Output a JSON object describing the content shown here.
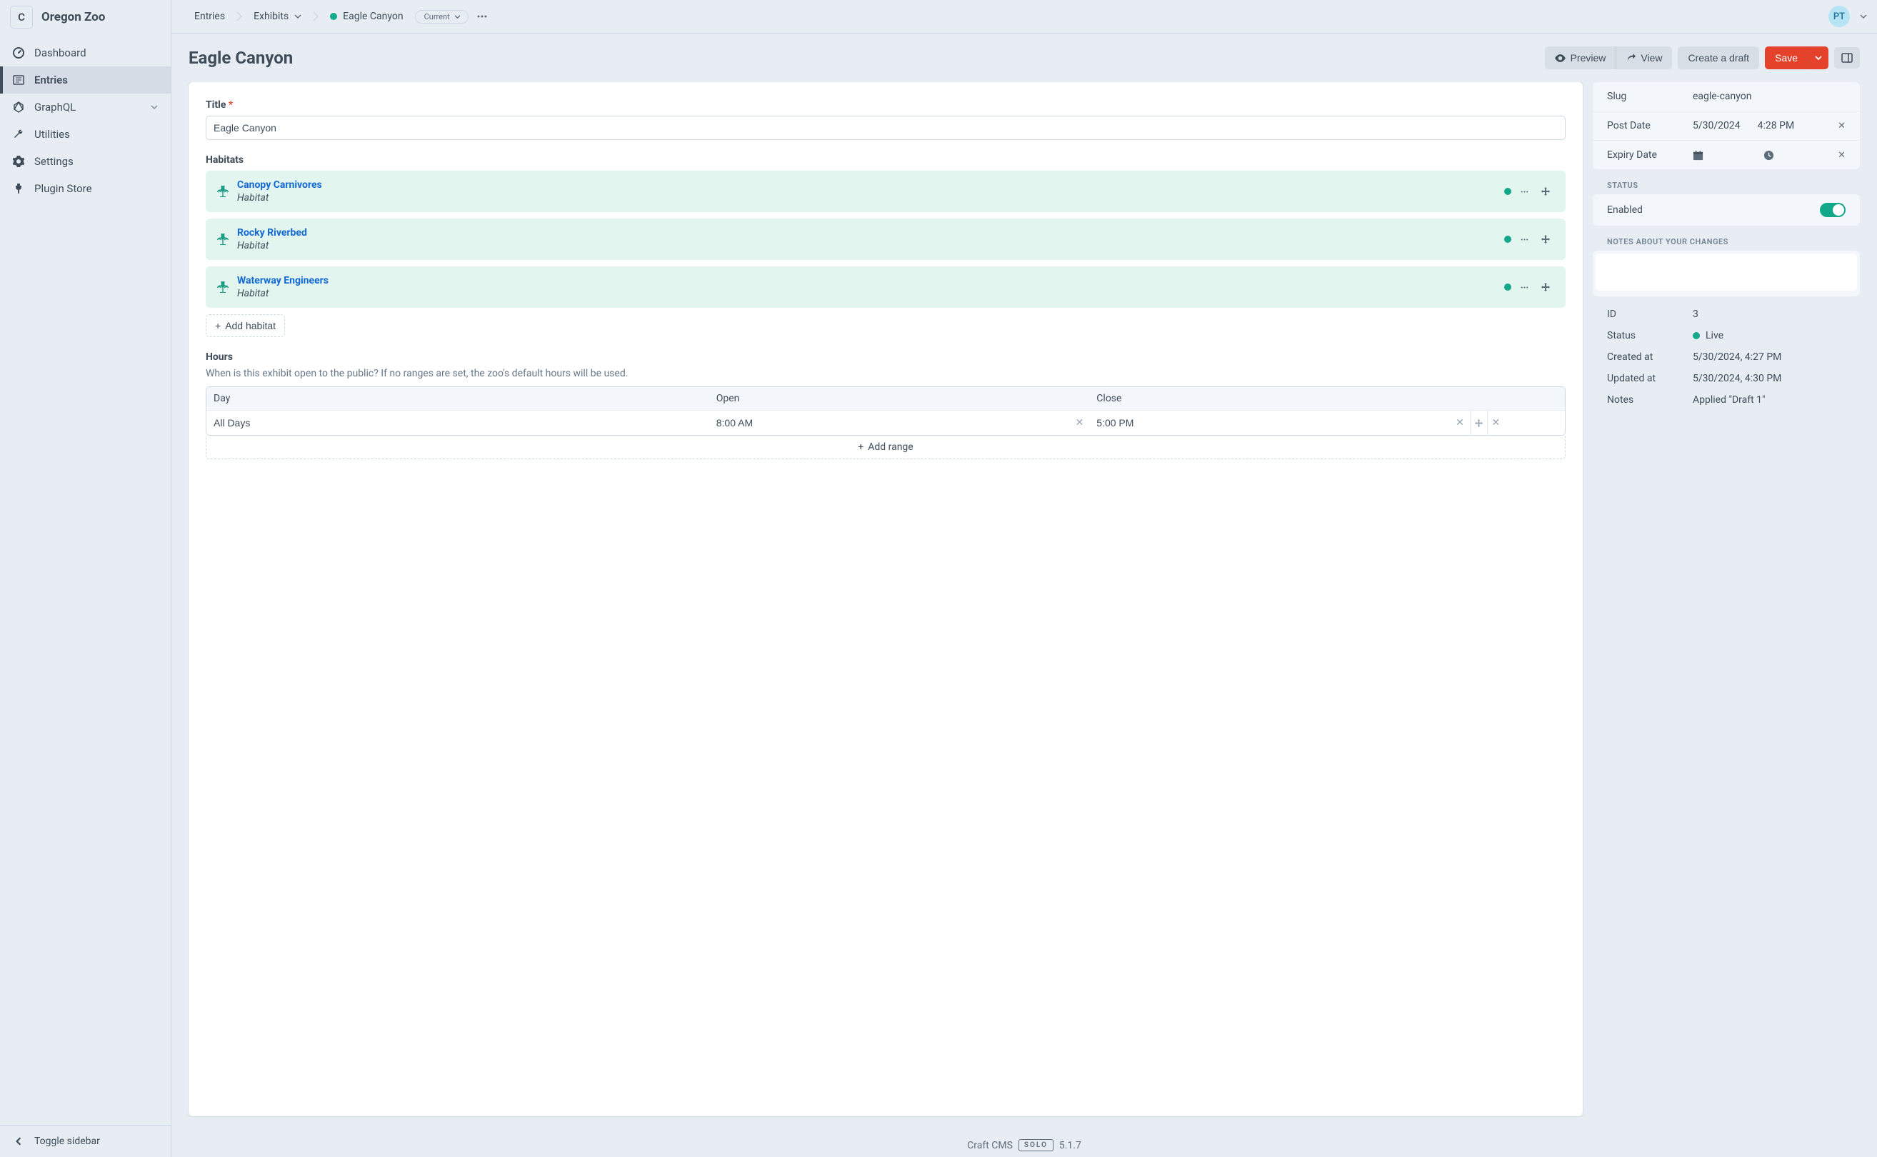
{
  "site": {
    "badge": "C",
    "name": "Oregon Zoo"
  },
  "nav": {
    "dashboard": "Dashboard",
    "entries": "Entries",
    "graphql": "GraphQL",
    "utilities": "Utilities",
    "settings": "Settings",
    "plugin_store": "Plugin Store",
    "toggle_sidebar": "Toggle sidebar"
  },
  "breadcrumb": {
    "entries": "Entries",
    "section": "Exhibits",
    "entry": "Eagle Canyon",
    "revision": "Current"
  },
  "user": {
    "initials": "PT"
  },
  "actions": {
    "preview": "Preview",
    "view": "View",
    "create_draft": "Create a draft",
    "save": "Save"
  },
  "page": {
    "title": "Eagle Canyon"
  },
  "fields": {
    "title_label": "Title",
    "title_value": "Eagle Canyon",
    "habitats_label": "Habitats",
    "add_habitat": "Add habitat",
    "hours_label": "Hours",
    "hours_help": "When is this exhibit open to the public? If no ranges are set, the zoo's default hours will be used.",
    "add_range": "Add range"
  },
  "habitats": [
    {
      "title": "Canopy Carnivores",
      "type": "Habitat"
    },
    {
      "title": "Rocky Riverbed",
      "type": "Habitat"
    },
    {
      "title": "Waterway Engineers",
      "type": "Habitat"
    }
  ],
  "hours_table": {
    "cols": {
      "day": "Day",
      "open": "Open",
      "close": "Close"
    },
    "rows": [
      {
        "day": "All Days",
        "open": "8:00 AM",
        "close": "5:00 PM"
      }
    ]
  },
  "meta": {
    "slug_label": "Slug",
    "slug": "eagle-canyon",
    "postdate_label": "Post Date",
    "postdate_date": "5/30/2024",
    "postdate_time": "4:28 PM",
    "expiry_label": "Expiry Date",
    "status_label": "STATUS",
    "enabled": "Enabled",
    "notes_label": "NOTES ABOUT YOUR CHANGES"
  },
  "info": {
    "id_label": "ID",
    "id": "3",
    "status_label": "Status",
    "status": "Live",
    "created_label": "Created at",
    "created": "5/30/2024, 4:27 PM",
    "updated_label": "Updated at",
    "updated": "5/30/2024, 4:30 PM",
    "notes_label": "Notes",
    "notes": "Applied \"Draft 1\""
  },
  "brand": {
    "product": "Craft CMS",
    "edition": "SOLO",
    "version": "5.1.7"
  }
}
